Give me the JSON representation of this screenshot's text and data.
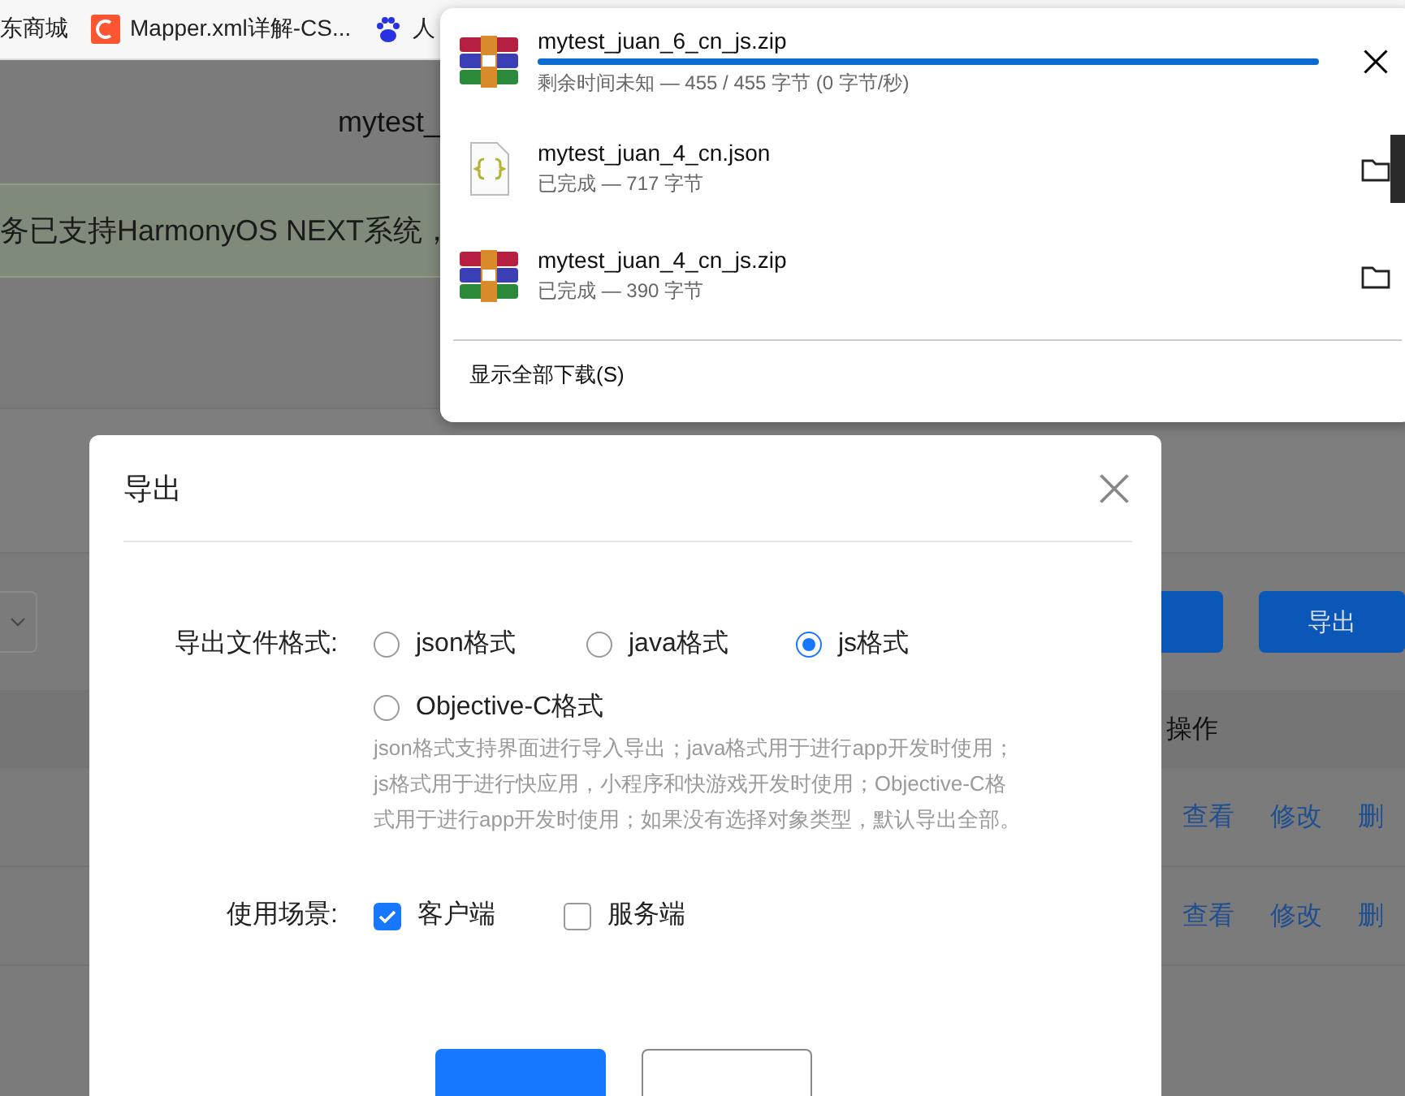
{
  "bookmarks": [
    {
      "kind": "none",
      "label": "东商城"
    },
    {
      "kind": "csdn",
      "label": "Mapper.xml详解-CS..."
    },
    {
      "kind": "paw",
      "label": "人"
    }
  ],
  "page": {
    "title": "mytest_",
    "notice": "务已支持HarmonyOS NEXT系统，",
    "export_button": "导出",
    "column_header": "操作",
    "row_actions": [
      [
        "查看",
        "修改",
        "删"
      ],
      [
        "查看",
        "修改",
        "删"
      ]
    ]
  },
  "downloads": {
    "items": [
      {
        "kind": "archive",
        "name": "mytest_juan_6_cn_js.zip",
        "status": "剩余时间未知 — 455 / 455 字节 (0 字节/秒)",
        "level": 1
      },
      {
        "kind": "json",
        "name": "mytest_juan_4_cn.json",
        "status": "已完成 — 717 字节",
        "covered": true
      },
      {
        "kind": "archive",
        "name": "mytest_juan_4_cn_js.zip",
        "status": "已完成 — 390 字节"
      }
    ],
    "show_all": "显示全部下载(S)"
  },
  "dialog": {
    "title": "导出",
    "format_label": "导出文件格式:",
    "formats": [
      {
        "label": "json格式",
        "selected": false
      },
      {
        "label": "java格式",
        "selected": false
      },
      {
        "label": "js格式",
        "selected": true
      },
      {
        "label": "Objective-C格式",
        "selected": false
      }
    ],
    "hint": "json格式支持界面进行导入导出；java格式用于进行app开发时使用；js格式用于进行快应用，小程序和快游戏开发时使用；Objective-C格式用于进行app开发时使用；如果没有选择对象类型，默认导出全部。",
    "scene_label": "使用场景:",
    "scenes": [
      {
        "label": "客户端",
        "checked": true
      },
      {
        "label": "服务端",
        "checked": false
      }
    ]
  }
}
